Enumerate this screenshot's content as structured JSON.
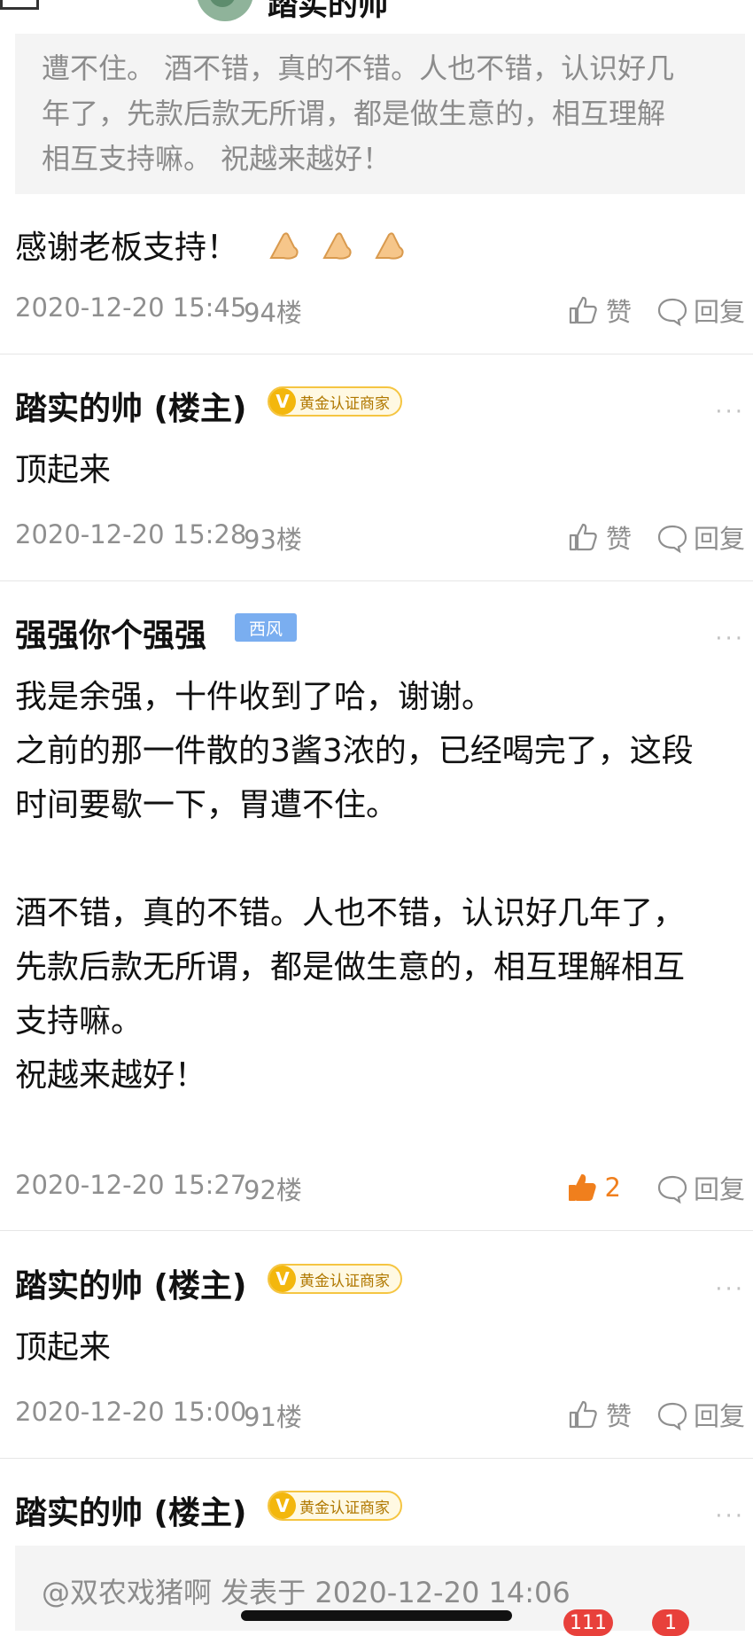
{
  "top": {
    "name": "踏实的帅"
  },
  "quote1": {
    "line1": "遭不住。 酒不错，真的不错。人也不错，认识好几",
    "line2": "年了，先款后款无所谓，都是做生意的，相互理解",
    "line3": "相互支持嘛。 祝越来越好！"
  },
  "reply94": {
    "text": "感谢老板支持！",
    "emoji": "folded-hands-icon"
  },
  "floor94": {
    "time": "2020-12-20 15:45",
    "floor": "94楼",
    "like": "赞",
    "reply": "回复"
  },
  "post93": {
    "user": "踏实的帅 (楼主)",
    "badge": "黄金认证商家",
    "badge_icon": "V",
    "more": "···",
    "text": "顶起来",
    "time": "2020-12-20 15:28",
    "floor": "93楼",
    "like": "赞",
    "reply": "回复"
  },
  "post92": {
    "user": "强强你个强强",
    "badge": "西风",
    "more": "···",
    "lines": [
      "我是余强，十件收到了哈，谢谢。",
      "之前的那一件散的3酱3浓的，已经喝完了，这段",
      "时间要歇一下，胃遭不住。",
      "酒不错，真的不错。人也不错，认识好几年了，",
      "先款后款无所谓，都是做生意的，相互理解相互",
      "支持嘛。",
      "祝越来越好！"
    ],
    "time": "2020-12-20 15:27",
    "floor": "92楼",
    "like_count": "2",
    "reply": "回复"
  },
  "post91": {
    "user": "踏实的帅 (楼主)",
    "badge": "黄金认证商家",
    "badge_icon": "V",
    "more": "···",
    "text": "顶起来",
    "time": "2020-12-20 15:00",
    "floor": "91楼",
    "like": "赞",
    "reply": "回复"
  },
  "post90": {
    "user": "踏实的帅 (楼主)",
    "badge": "黄金认证商家",
    "badge_icon": "V",
    "more": "···",
    "quote": "@双农戏猪啊 发表于 2020-12-20 14:06"
  },
  "bottom": {
    "badge1": "111",
    "badge2": "1"
  },
  "colors": {
    "accent": "#f07f1d",
    "gold": "#f3b70d",
    "blue_badge": "#7aaef0",
    "red_badge": "#e8403b"
  }
}
